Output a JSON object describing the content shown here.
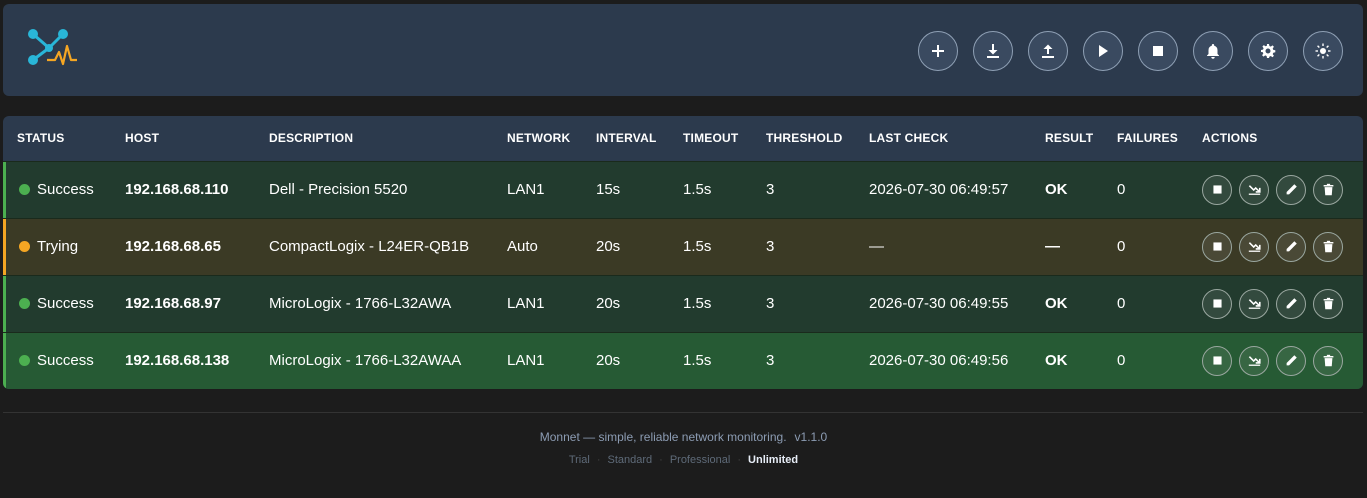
{
  "header": {
    "logo_icon": "monnet-logo-icon",
    "buttons": [
      {
        "name": "add-button",
        "icon": "plus-icon"
      },
      {
        "name": "import-button",
        "icon": "download-icon"
      },
      {
        "name": "export-button",
        "icon": "upload-icon"
      },
      {
        "name": "start-all-button",
        "icon": "play-icon"
      },
      {
        "name": "stop-all-button",
        "icon": "stop-icon"
      },
      {
        "name": "notifications-button",
        "icon": "bell-icon"
      },
      {
        "name": "settings-button",
        "icon": "gear-icon"
      },
      {
        "name": "theme-toggle-button",
        "icon": "sun-icon"
      }
    ]
  },
  "table": {
    "columns": [
      "STATUS",
      "HOST",
      "DESCRIPTION",
      "NETWORK",
      "INTERVAL",
      "TIMEOUT",
      "THRESHOLD",
      "LAST CHECK",
      "RESULT",
      "FAILURES",
      "ACTIONS"
    ],
    "rows": [
      {
        "status": "Success",
        "status_color": "#4caf50",
        "host": "192.168.68.110",
        "description": "Dell - Precision 5520",
        "network": "LAN1",
        "interval": "15s",
        "timeout": "1.5s",
        "threshold": "3",
        "last_check": "2026-07-30 06:49:57",
        "result": "OK",
        "failures": "0"
      },
      {
        "status": "Trying",
        "status_color": "#f5a623",
        "host": "192.168.68.65",
        "description": "CompactLogix - L24ER-QB1B",
        "network": "Auto",
        "interval": "20s",
        "timeout": "1.5s",
        "threshold": "3",
        "last_check": "—",
        "result": "—",
        "failures": "0"
      },
      {
        "status": "Success",
        "status_color": "#4caf50",
        "host": "192.168.68.97",
        "description": "MicroLogix - 1766-L32AWA",
        "network": "LAN1",
        "interval": "20s",
        "timeout": "1.5s",
        "threshold": "3",
        "last_check": "2026-07-30 06:49:55",
        "result": "OK",
        "failures": "0"
      },
      {
        "status": "Success",
        "status_color": "#4caf50",
        "host": "192.168.68.138",
        "description": "MicroLogix - 1766-L32AWAA",
        "network": "LAN1",
        "interval": "20s",
        "timeout": "1.5s",
        "threshold": "3",
        "last_check": "2026-07-30 06:49:56",
        "result": "OK",
        "failures": "0"
      }
    ],
    "row_actions": [
      "stop-icon",
      "trend-icon",
      "pencil-icon",
      "trash-icon"
    ]
  },
  "footer": {
    "tagline": "Monnet — simple, reliable network monitoring.",
    "version": "v1.1.0",
    "plans": [
      "Trial",
      "Standard",
      "Professional",
      "Unlimited"
    ],
    "active_plan": "Unlimited",
    "separator": "·"
  }
}
